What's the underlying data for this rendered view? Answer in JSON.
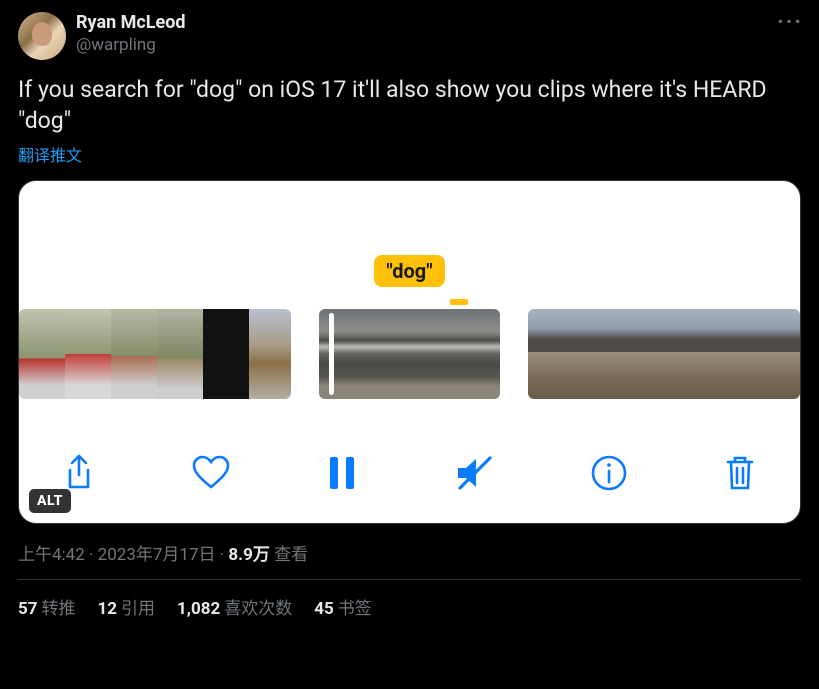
{
  "author": {
    "display_name": "Ryan McLeod",
    "handle": "@warpling"
  },
  "more_glyph": "···",
  "body": "If you search for \"dog\" on iOS 17 it'll also show you clips where it's HEARD \"dog\"",
  "translate_label": "翻译推文",
  "media": {
    "search_pill": "\"dog\"",
    "alt_badge": "ALT",
    "toolbar_icons": {
      "share": "share-icon",
      "like": "heart-icon",
      "pause": "pause-icon",
      "mute": "mute-icon",
      "info": "info-icon",
      "trash": "trash-icon"
    }
  },
  "meta": {
    "time": "上午4:42",
    "sep": " · ",
    "date": "2023年7月17日",
    "views_num": "8.9万",
    "views_label": " 查看"
  },
  "stats": {
    "retweets": {
      "count": "57",
      "label": "转推"
    },
    "quotes": {
      "count": "12",
      "label": "引用"
    },
    "likes": {
      "count": "1,082",
      "label": "喜欢次数"
    },
    "bookmarks": {
      "count": "45",
      "label": "书签"
    }
  }
}
